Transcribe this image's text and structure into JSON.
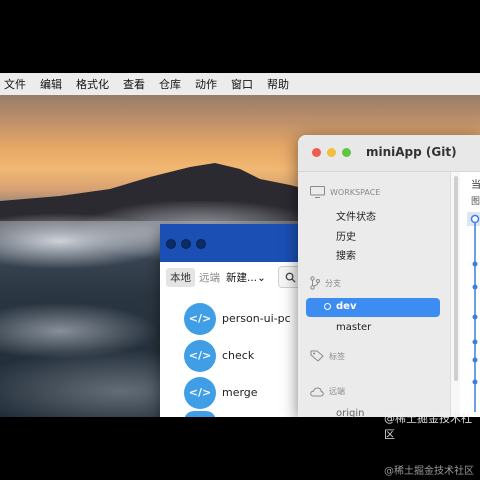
{
  "menubar": {
    "items": [
      "文件",
      "编辑",
      "格式化",
      "查看",
      "仓库",
      "动作",
      "窗口",
      "帮助"
    ]
  },
  "small_window": {
    "segments": [
      "本地",
      "远端"
    ],
    "new_button": "新建...",
    "dropdown_icon": "chevron-down-icon",
    "search_icon": "search-icon",
    "repos": [
      {
        "name": "person-ui-pc",
        "icon": "code-icon"
      },
      {
        "name": "check",
        "icon": "code-icon"
      },
      {
        "name": "merge",
        "icon": "code-icon"
      }
    ]
  },
  "main_window": {
    "title": "miniApp (Git)",
    "sidebar": {
      "workspace_label": "WORKSPACE",
      "workspace_items": [
        "文件状态",
        "历史",
        "搜索"
      ],
      "branch_label": "分支",
      "branches": [
        "dev",
        "master"
      ],
      "current_branch": "dev",
      "tags_label": "标签",
      "remote_label": "远端",
      "partial_item": "origin"
    },
    "detail": {
      "header_partial": "当",
      "sub_partial": "图"
    }
  },
  "watermark": "@稀土掘金技术社区",
  "colors": {
    "accent_blue": "#3c8cf2",
    "repo_icon_blue": "#3f9ee6",
    "small_titlebar": "#1b4fb4",
    "close_red": "#ee5b52",
    "minimize_yellow": "#f4bd3a",
    "zoom_green": "#5fc73f"
  }
}
